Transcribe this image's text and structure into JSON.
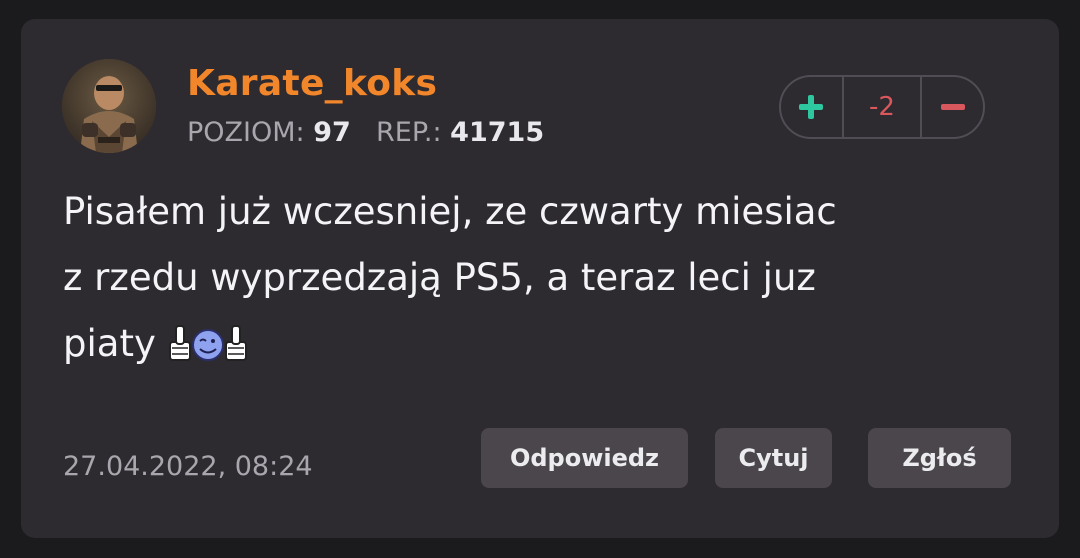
{
  "post": {
    "author": {
      "username": "Karate_koks",
      "level_label": "POZIOM:",
      "level": "97",
      "rep_label": "REP.:",
      "rep": "41715"
    },
    "vote": {
      "plus_icon": "plus-icon",
      "score": "-2",
      "minus_icon": "minus-icon"
    },
    "content": {
      "line1": "Pisałem już wczesniej, ze czwarty miesiac",
      "line2": "z rzedu wyprzedzają PS5, a teraz leci juz",
      "line3": "piaty",
      "emoticon": "thumbs-up-smiley-emoticon"
    },
    "date": "27.04.2022, 08:24",
    "actions": {
      "reply": "Odpowiedz",
      "quote": "Cytuj",
      "report": "Zgłoś"
    }
  },
  "colors": {
    "username": "#f1862a",
    "plus": "#2ec8a0",
    "minus": "#d8585d",
    "background": "#1b1a1d",
    "card": "#2d2a30"
  }
}
